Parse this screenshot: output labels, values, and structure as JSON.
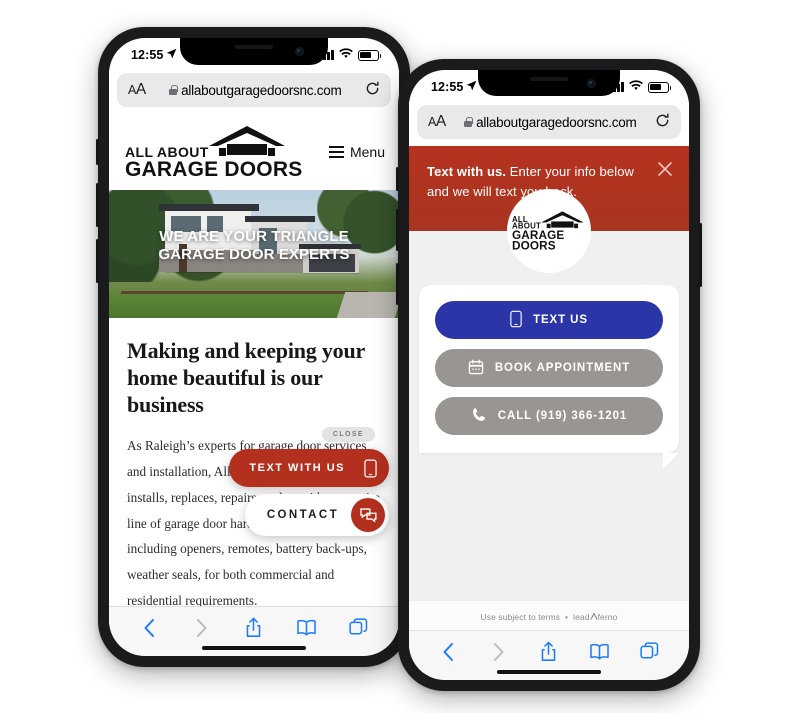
{
  "status_bar": {
    "time": "12:55",
    "location_icon": "location-arrow-icon",
    "signal_icon": "cellular-signal-icon",
    "wifi_icon": "wifi-icon",
    "battery_icon": "battery-icon"
  },
  "browser": {
    "text_size_label": "AA",
    "lock_icon": "lock-icon",
    "url": "allaboutgaragedoorsnc.com",
    "reload_icon": "reload-icon",
    "toolbar": {
      "back_icon": "chevron-left-icon",
      "forward_icon": "chevron-right-icon",
      "share_icon": "share-icon",
      "bookmarks_icon": "book-icon",
      "tabs_icon": "tabs-icon"
    }
  },
  "site": {
    "logo": {
      "line1": "ALL ABOUT",
      "line2": "GARAGE DOORS",
      "mark": "garage-roof-icon"
    },
    "menu": {
      "icon": "hamburger-icon",
      "label": "Menu"
    },
    "hero": {
      "line1": "WE ARE YOUR TRIANGLE",
      "line2": "GARAGE DOOR EXPERTS"
    },
    "article": {
      "heading": "Making and keeping your home beautiful is our business",
      "paragraph": "As Raleigh’s experts for garage door services and installation, All About Garage Doors installs, replaces, repairs, and provides an entire line of garage door hardware and accessories, including openers, remotes, battery back-ups, weather seals, for both commercial and residential requirements."
    },
    "floating_widget": {
      "close_label": "CLOSE",
      "text_with_us_label": "TEXT WITH US",
      "text_with_us_icon": "mobile-phone-icon",
      "contact_label": "CONTACT",
      "contact_icon": "chat-bubbles-icon"
    }
  },
  "widget": {
    "header": {
      "bold_text": "Text with us.",
      "rest_text": " Enter your info below and we will text you back.",
      "close_icon": "close-x-icon"
    },
    "logo": {
      "line1": "ALL ABOUT",
      "line2": "GARAGE DOORS",
      "mark": "garage-roof-icon"
    },
    "buttons": [
      {
        "label": "TEXT US",
        "icon": "mobile-phone-icon",
        "style": "blue"
      },
      {
        "label": "BOOK APPOINTMENT",
        "icon": "calendar-icon",
        "style": "gray"
      },
      {
        "label": "CALL (919) 366-1201",
        "icon": "phone-handset-icon",
        "style": "gray"
      }
    ],
    "footer": {
      "terms": "Use subject to terms",
      "separator": "•",
      "brand_pre": "lead",
      "brand_mark": "chevron-up-icon",
      "brand_post": "ferno"
    }
  },
  "colors": {
    "brand_red": "#b3301f",
    "widget_header_red": "#b5321f",
    "button_blue": "#2b35a8",
    "button_gray": "#989592",
    "safari_blue": "#1a7bff",
    "widget_bg": "#eff0f2"
  }
}
